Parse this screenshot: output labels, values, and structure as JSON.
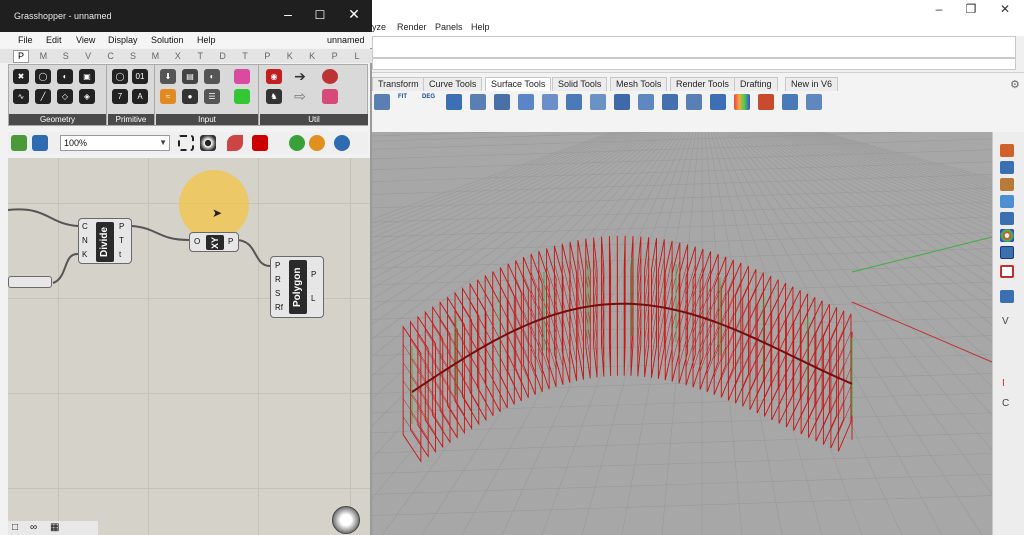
{
  "grasshopper": {
    "title": "Grasshopper - unnamed",
    "document": "unnamed",
    "menu": [
      "File",
      "Edit",
      "View",
      "Display",
      "Solution",
      "Help"
    ],
    "tabs": [
      "P",
      "M",
      "S",
      "V",
      "C",
      "S",
      "M",
      "X",
      "T",
      "D",
      "T",
      "P",
      "K",
      "K",
      "P",
      "L"
    ],
    "active_tab": "P",
    "groups": [
      "Geometry",
      "Primitive",
      "Input",
      "Util"
    ],
    "zoom": "100%",
    "components": {
      "divide": {
        "name": "Divide",
        "inputs": [
          "C",
          "N",
          "K"
        ],
        "outputs": [
          "P",
          "T",
          "t"
        ]
      },
      "xy": {
        "name": "XY",
        "inputs": [
          "O"
        ],
        "outputs": [
          "P"
        ]
      },
      "polygon": {
        "name": "Polygon",
        "inputs": [
          "P",
          "R",
          "S",
          "Rf"
        ],
        "outputs": [
          "P",
          "L"
        ]
      }
    }
  },
  "rhino": {
    "menu_partial": [
      "yze",
      "Render",
      "Panels",
      "Help"
    ],
    "tabs": [
      "Transform",
      "Curve Tools",
      "Surface Tools",
      "Solid Tools",
      "Mesh Tools",
      "Render Tools",
      "Drafting",
      "New in V6"
    ],
    "active_tab": "Surface Tools",
    "icon_labels": [
      "FIT",
      "DEG"
    ],
    "side_letters": [
      "V",
      "I",
      "C"
    ]
  },
  "colors": {
    "geometry_red": "#c81414",
    "viewport_bg": "#a7a7a7",
    "grid_line": "#9a9a9a",
    "axis_green": "#3fae3f",
    "axis_red": "#c03030",
    "cursor_halo": "#f4c446"
  }
}
